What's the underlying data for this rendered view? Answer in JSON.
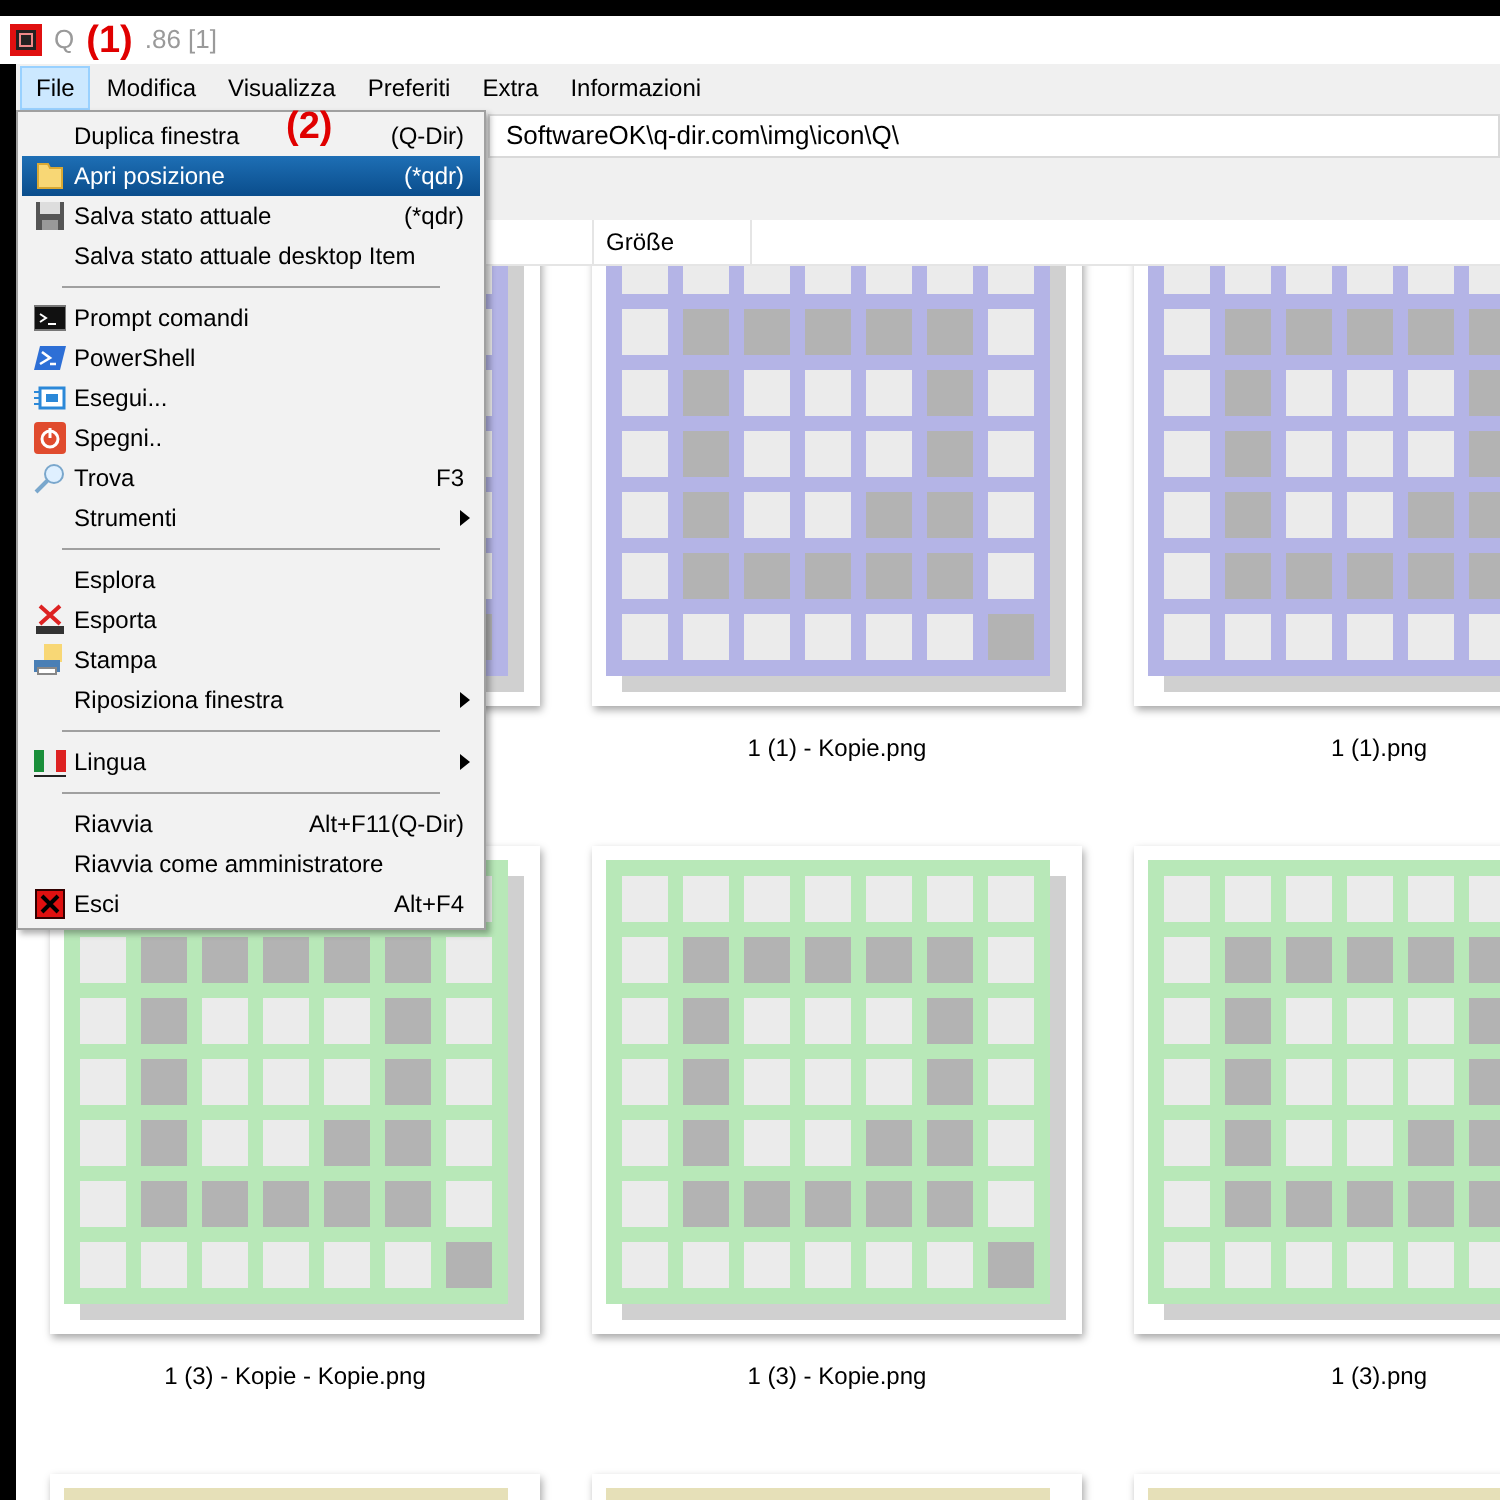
{
  "window": {
    "title_start": "Q",
    "title_end": ".86 [1]"
  },
  "annotations": [
    "(1)",
    "(2)"
  ],
  "menu_bar": [
    {
      "label": "File",
      "selected": true
    },
    {
      "label": "Modifica",
      "selected": false
    },
    {
      "label": "Visualizza",
      "selected": false
    },
    {
      "label": "Preferiti",
      "selected": false
    },
    {
      "label": "Extra",
      "selected": false
    },
    {
      "label": "Informazioni",
      "selected": false
    }
  ],
  "address_bar": {
    "path": "SoftwareOK\\q-dir.com\\img\\icon\\Q\\"
  },
  "columns": [
    "Größe"
  ],
  "file_menu": [
    [
      {
        "label": "Duplica finestra",
        "shortcut": "(Q-Dir)",
        "selected": false,
        "submenu": false
      },
      {
        "label": "Apri posizione",
        "shortcut": "(*qdr)",
        "kind": "folder",
        "selected": true,
        "submenu": false
      },
      {
        "label": "Salva stato attuale",
        "shortcut": "(*qdr)",
        "kind": "save",
        "selected": false,
        "submenu": false
      },
      {
        "label": "Salva stato attuale desktop Item",
        "selected": false,
        "submenu": false
      }
    ],
    [
      {
        "label": "Prompt comandi",
        "kind": "cmd",
        "selected": false,
        "submenu": false
      },
      {
        "label": "PowerShell",
        "kind": "powershell",
        "selected": false,
        "submenu": false
      },
      {
        "label": "Esegui...",
        "kind": "run",
        "selected": false,
        "submenu": false
      },
      {
        "label": "Spegni..",
        "kind": "power",
        "selected": false,
        "submenu": false
      },
      {
        "label": "Trova",
        "shortcut": "F3",
        "kind": "search",
        "selected": false,
        "submenu": false
      },
      {
        "label": "Strumenti",
        "selected": false,
        "submenu": true
      }
    ],
    [
      {
        "label": "Esplora",
        "selected": false,
        "submenu": false
      },
      {
        "label": "Esporta",
        "kind": "export",
        "selected": false,
        "submenu": false
      },
      {
        "label": "Stampa",
        "kind": "print",
        "selected": false,
        "submenu": false
      },
      {
        "label": "Riposiziona finestra",
        "selected": false,
        "submenu": true
      }
    ],
    [
      {
        "label": "Lingua",
        "kind": "flag",
        "selected": false,
        "submenu": true
      }
    ],
    [
      {
        "label": "Riavvia",
        "shortcut": "Alt+F11(Q-Dir)",
        "selected": false,
        "submenu": false
      },
      {
        "label": "Riavvia come amministratore",
        "selected": false,
        "submenu": false
      },
      {
        "label": "Esci",
        "shortcut": "Alt+F4",
        "kind": "close",
        "selected": false,
        "submenu": false
      }
    ]
  ],
  "thumbnails": [
    [
      {
        "color": "#b4b4e6"
      },
      {
        "name": "1 (1) - Kopie.png",
        "color": "#b4b4e6"
      },
      {
        "name": "1 (1).png",
        "color": "#b4b4e6"
      }
    ],
    [
      {
        "name": "1 (3) - Kopie - Kopie.png",
        "color": "#b8e8b8"
      },
      {
        "name": "1 (3) - Kopie.png",
        "color": "#b8e8b8"
      },
      {
        "name": "1 (3).png",
        "color": "#b8e8b8"
      }
    ],
    [
      {
        "color": "#e6e0b8"
      },
      {
        "color": "#e6e0b8"
      },
      {
        "color": "#e6e0b8"
      }
    ]
  ]
}
